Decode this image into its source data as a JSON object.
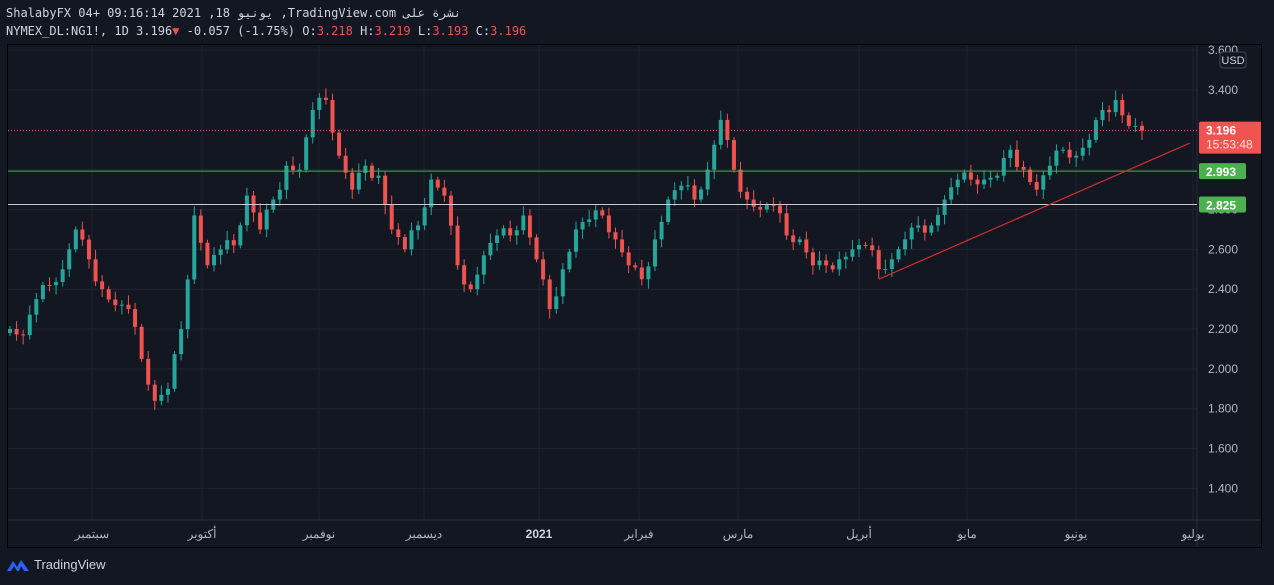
{
  "header": {
    "line1": "ShalabyFX 04+ 09:16:14 2021 ,18 يونيو ,TradingView.com نشرة على",
    "symbol": "NYMEX_DL:NG1!, 1D 3.196",
    "down_arrow": "▼",
    "change": "-0.057 (-1.75%)",
    "o_label": "O:",
    "o": "3.218",
    "h_label": "H:",
    "h": "3.219",
    "l_label": "L:",
    "l": "3.193",
    "c_label": "C:",
    "c": "3.196"
  },
  "logo_text": "TradingView",
  "colors": {
    "up": "#26a69a",
    "down": "#ef5350",
    "bg": "#131722",
    "grid": "#1f2330",
    "level_green": "#4caf50"
  },
  "chart_data": {
    "type": "candlestick",
    "symbol": "NYMEX_DL:NG1!",
    "interval": "1D",
    "currency": "USD",
    "ylim": [
      1.3,
      3.62
    ],
    "yticks": [
      "3.600",
      "3.400",
      "3.200",
      "3.000",
      "2.800",
      "2.600",
      "2.400",
      "2.200",
      "2.000",
      "1.800",
      "1.600",
      "1.400"
    ],
    "xticks": [
      "سبتمبر",
      "أكتوبر",
      "نوفمبر",
      "ديسمبر",
      "2021",
      "فبراير",
      "مارس",
      "أبريل",
      "مايو",
      "يونيو",
      "يوليو"
    ],
    "closes": [
      2.2,
      2.17,
      2.35,
      2.42,
      2.5,
      2.7,
      2.55,
      2.4,
      2.32,
      2.3,
      2.05,
      1.84,
      1.9,
      2.2,
      2.77,
      2.52,
      2.6,
      2.62,
      2.87,
      2.7,
      2.85,
      3.02,
      3.0,
      3.3,
      3.35,
      3.07,
      2.9,
      3.02,
      2.97,
      2.7,
      2.6,
      2.72,
      2.95,
      2.87,
      2.52,
      2.4,
      2.57,
      2.67,
      2.67,
      2.77,
      2.55,
      2.3,
      2.5,
      2.7,
      2.75,
      2.77,
      2.65,
      2.52,
      2.45,
      2.65,
      2.85,
      2.92,
      2.85,
      3.0,
      3.25,
      3.0,
      2.85,
      2.8,
      2.82,
      2.67,
      2.65,
      2.52,
      2.52,
      2.55,
      2.6,
      2.62,
      2.5,
      2.55,
      2.65,
      2.72,
      2.72,
      2.85,
      2.95,
      2.95,
      2.95,
      2.97,
      3.1,
      3.0,
      2.9,
      3.02,
      3.1,
      3.07,
      3.15,
      3.3,
      3.35,
      3.22,
      3.196
    ],
    "last_price": "3.196",
    "countdown": "15:53:48",
    "levels": [
      {
        "value": 2.993,
        "label": "2.993",
        "color": "#4caf50"
      },
      {
        "value": 2.825,
        "label": "2.825",
        "color": "#4caf50"
      }
    ],
    "trendline": {
      "from_index": 66,
      "from_value": 2.45,
      "to_index": 90,
      "to_value": 3.15
    }
  }
}
